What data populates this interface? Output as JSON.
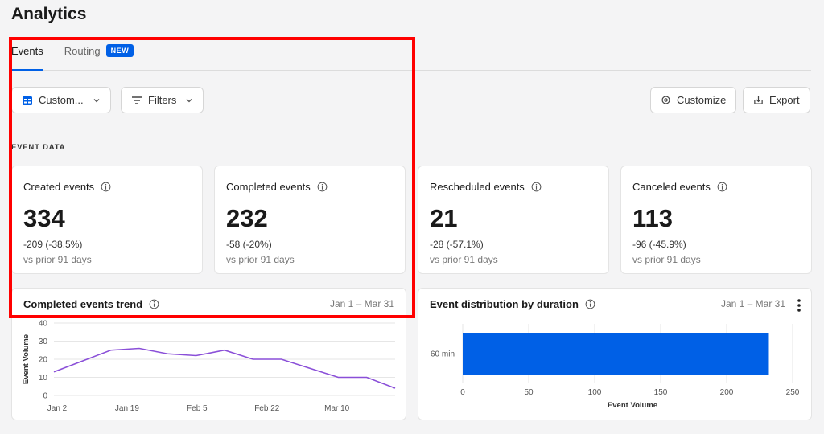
{
  "page": {
    "title": "Analytics"
  },
  "tabs": [
    {
      "label": "Events",
      "active": true
    },
    {
      "label": "Routing",
      "badge": "NEW"
    }
  ],
  "toolbar": {
    "date_filter_label": "Custom...",
    "filters_label": "Filters",
    "customize_label": "Customize",
    "export_label": "Export"
  },
  "section": {
    "label": "EVENT DATA"
  },
  "stats": [
    {
      "title": "Created events",
      "value": "334",
      "change": "-209 (-38.5%)",
      "prior": "vs prior 91 days"
    },
    {
      "title": "Completed events",
      "value": "232",
      "change": "-58 (-20%)",
      "prior": "vs prior 91 days"
    },
    {
      "title": "Rescheduled events",
      "value": "21",
      "change": "-28 (-57.1%)",
      "prior": "vs prior 91 days"
    },
    {
      "title": "Canceled events",
      "value": "113",
      "change": "-96 (-45.9%)",
      "prior": "vs prior 91 days"
    }
  ],
  "trend_card": {
    "title": "Completed events trend",
    "range": "Jan 1 – Mar 31"
  },
  "distribution_card": {
    "title": "Event distribution by duration",
    "range": "Jan 1 – Mar 31"
  },
  "colors": {
    "accent": "#0060e6",
    "line": "#8a4fd8",
    "highlight": "#ff0000"
  },
  "chart_data": [
    {
      "type": "line",
      "title": "Completed events trend",
      "ylabel": "Event Volume",
      "xlabel": "",
      "ylim": [
        0,
        40
      ],
      "yticks": [
        0,
        10,
        20,
        30,
        40
      ],
      "xticks": [
        "Jan 2",
        "Jan 19",
        "Feb 5",
        "Feb 22",
        "Mar 10"
      ],
      "series": [
        {
          "values": [
            13,
            19,
            25,
            26,
            23,
            22,
            25,
            20,
            20,
            15,
            10,
            10,
            4
          ]
        }
      ],
      "grid": true
    },
    {
      "type": "bar",
      "orientation": "horizontal",
      "title": "Event distribution by duration",
      "categories": [
        "60 min"
      ],
      "values": [
        232
      ],
      "xlabel": "Event Volume",
      "xlim": [
        0,
        250
      ],
      "xticks": [
        0,
        50,
        100,
        150,
        200,
        250
      ],
      "grid": true
    }
  ]
}
